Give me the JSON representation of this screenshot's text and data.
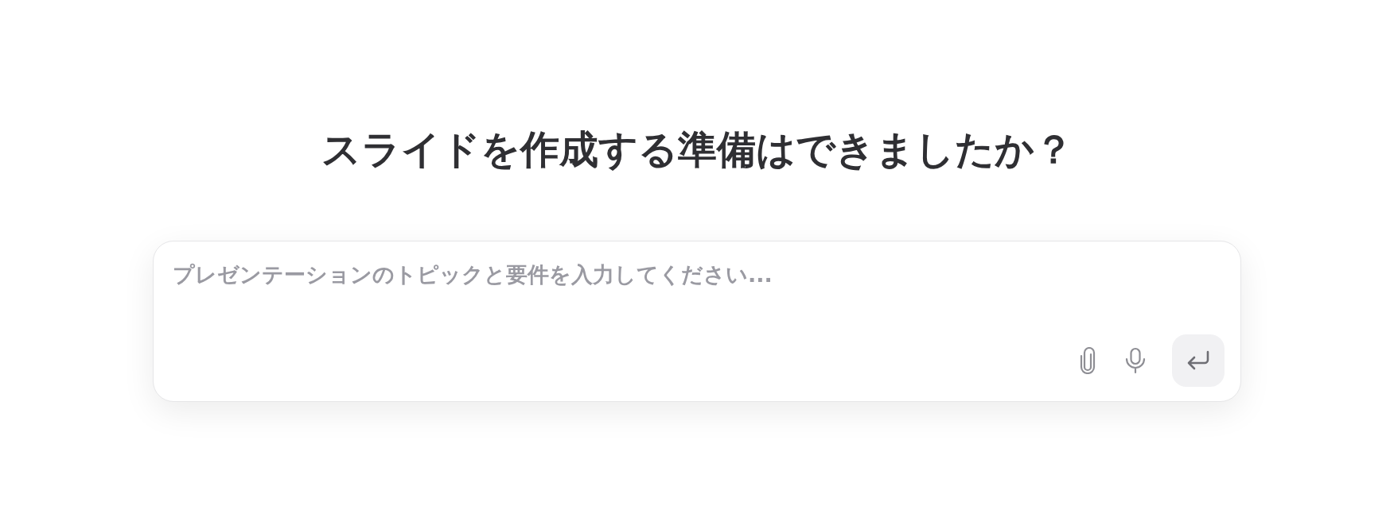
{
  "heading": "スライドを作成する準備はできましたか？",
  "prompt": {
    "placeholder": "プレゼンテーションのトピックと要件を入力してください..."
  }
}
